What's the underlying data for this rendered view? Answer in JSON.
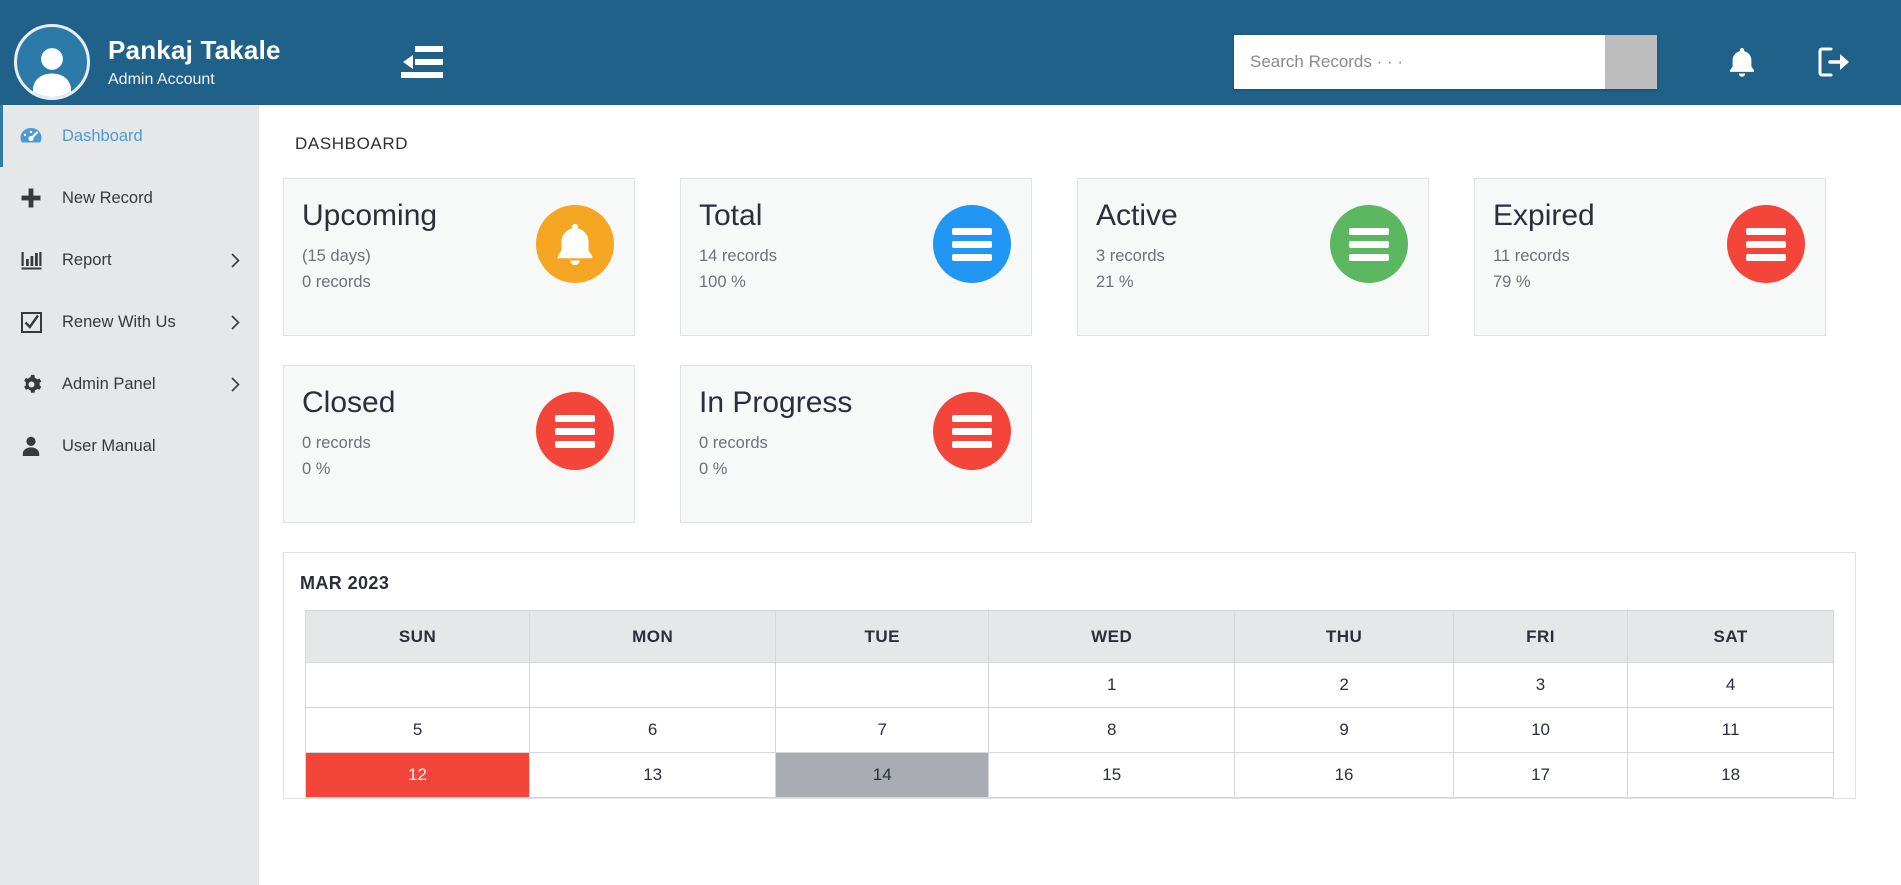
{
  "header": {
    "user_name": "Pankaj Takale",
    "user_role": "Admin Account",
    "avatar_icon": "user-avatar-icon",
    "menu_toggle_icon": "collapse-menu-icon",
    "search_placeholder": "Search Records · · ·",
    "search_value": "",
    "search_button_icon": "search-icon",
    "notification_icon": "bell-icon",
    "logout_icon": "sign-out-icon",
    "bg_color": "#1f6189"
  },
  "sidebar": {
    "items": [
      {
        "label": "Dashboard",
        "icon": "dashboard-gauge-icon",
        "active": true,
        "caret": false
      },
      {
        "label": "New Record",
        "icon": "plus-icon",
        "active": false,
        "caret": false
      },
      {
        "label": "Report",
        "icon": "bar-chart-icon",
        "active": false,
        "caret": true
      },
      {
        "label": "Renew With Us",
        "icon": "check-square-icon",
        "active": false,
        "caret": true
      },
      {
        "label": "Admin Panel",
        "icon": "gear-icon",
        "active": false,
        "caret": true
      },
      {
        "label": "User Manual",
        "icon": "user-icon",
        "active": false,
        "caret": false
      }
    ]
  },
  "main": {
    "page_title": "DASHBOARD",
    "cards": [
      {
        "title": "Upcoming",
        "subtitle": "(15 days)",
        "records": "0 records",
        "percent": "",
        "icon": "bell-icon",
        "color": "#f5a623"
      },
      {
        "title": "Total",
        "subtitle": "",
        "records": "14 records",
        "percent": "100 %",
        "icon": "list-bars-icon",
        "color": "#2196f3"
      },
      {
        "title": "Active",
        "subtitle": "",
        "records": "3 records",
        "percent": "21 %",
        "icon": "list-bars-icon",
        "color": "#5cb860"
      },
      {
        "title": "Expired",
        "subtitle": "",
        "records": "11 records",
        "percent": "79 %",
        "icon": "list-bars-icon",
        "color": "#f4453a"
      },
      {
        "title": "Closed",
        "subtitle": "",
        "records": "0 records",
        "percent": "0 %",
        "icon": "list-bars-icon",
        "color": "#f4453a"
      },
      {
        "title": "In Progress",
        "subtitle": "",
        "records": "0 records",
        "percent": "0 %",
        "icon": "list-bars-icon",
        "color": "#f4453a"
      }
    ],
    "calendar": {
      "month_label": "MAR 2023",
      "day_headers": [
        "SUN",
        "MON",
        "TUE",
        "WED",
        "THU",
        "FRI",
        "SAT"
      ],
      "weeks": [
        [
          {
            "d": "",
            "s": ""
          },
          {
            "d": "",
            "s": ""
          },
          {
            "d": "",
            "s": ""
          },
          {
            "d": "1",
            "s": ""
          },
          {
            "d": "2",
            "s": ""
          },
          {
            "d": "3",
            "s": ""
          },
          {
            "d": "4",
            "s": ""
          }
        ],
        [
          {
            "d": "5",
            "s": ""
          },
          {
            "d": "6",
            "s": ""
          },
          {
            "d": "7",
            "s": ""
          },
          {
            "d": "8",
            "s": ""
          },
          {
            "d": "9",
            "s": ""
          },
          {
            "d": "10",
            "s": ""
          },
          {
            "d": "11",
            "s": ""
          }
        ],
        [
          {
            "d": "12",
            "s": "red"
          },
          {
            "d": "13",
            "s": ""
          },
          {
            "d": "14",
            "s": "gray"
          },
          {
            "d": "15",
            "s": ""
          },
          {
            "d": "16",
            "s": ""
          },
          {
            "d": "17",
            "s": ""
          },
          {
            "d": "18",
            "s": ""
          }
        ]
      ],
      "highlight_red_color": "#f4453a",
      "highlight_gray_color": "#a9adb3"
    }
  }
}
